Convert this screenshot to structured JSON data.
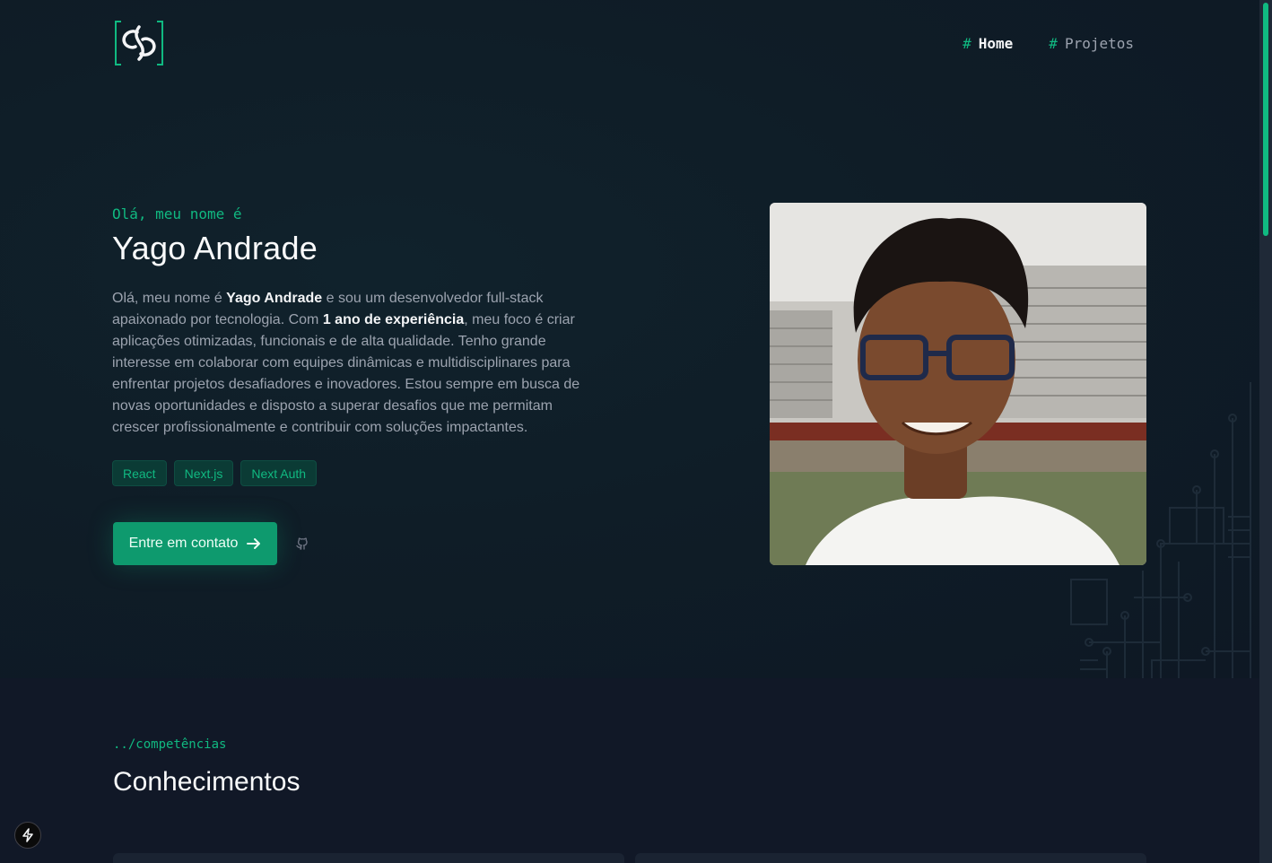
{
  "nav": {
    "items": [
      {
        "hash": "#",
        "label": "Home"
      },
      {
        "hash": "#",
        "label": "Projetos"
      }
    ]
  },
  "hero": {
    "greeting": "Olá, meu nome é",
    "name": "Yago Andrade",
    "bio": {
      "p1": "Olá, meu nome é ",
      "b1": "Yago Andrade",
      "p2": " e sou um desenvolvedor full-stack apaixonado por tecnologia. Com ",
      "b2": "1 ano de experiência",
      "p3": ", meu foco é criar aplicações otimizadas, funcionais e de alta qualidade. Tenho grande interesse em colaborar com equipes dinâmicas e multidisciplinares para enfrentar projetos desafiadores e inovadores. Estou sempre em busca de novas oportunidades e disposto a superar desafios que me permitam crescer profissionalmente e contribuir com soluções impactantes."
    },
    "tags": [
      "React",
      "Next.js",
      "Next Auth"
    ],
    "cta_label": "Entre em contato"
  },
  "skills": {
    "crumb": "../competências",
    "title": "Conhecimentos"
  },
  "colors": {
    "accent": "#10b981",
    "background": "#111827",
    "cta": "#0e9a6e"
  },
  "icons": [
    "logo-icon",
    "arrow-right-icon",
    "github-icon",
    "next-icon"
  ]
}
